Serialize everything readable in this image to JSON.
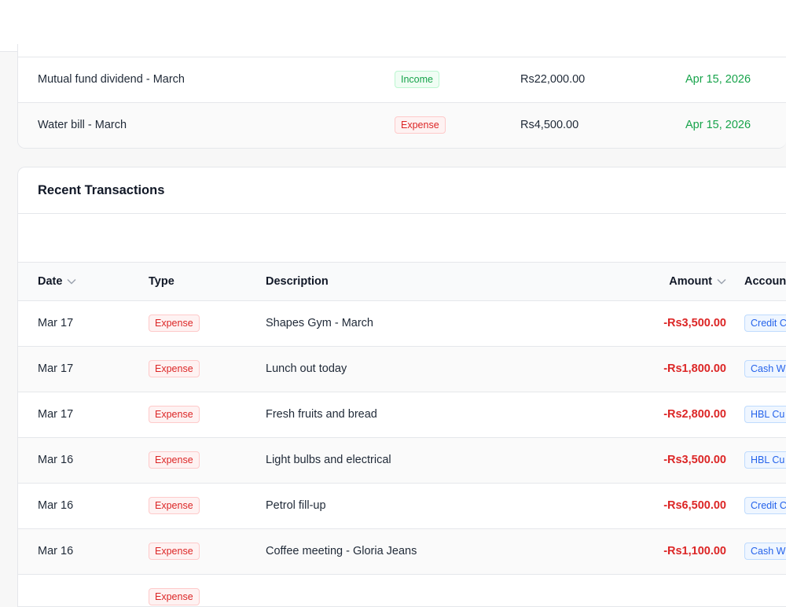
{
  "upcoming": {
    "rows": [
      {
        "description": "Mutual fund dividend - March",
        "type": "Income",
        "amount": "Rs22,000.00",
        "date": "Apr 15, 2026"
      },
      {
        "description": "Water bill - March",
        "type": "Expense",
        "amount": "Rs4,500.00",
        "date": "Apr 15, 2026"
      }
    ]
  },
  "recent": {
    "title": "Recent Transactions",
    "columns": {
      "date": "Date",
      "type": "Type",
      "description": "Description",
      "amount": "Amount",
      "account": "Accoun"
    },
    "rows": [
      {
        "date": "Mar 17",
        "type": "Expense",
        "description": "Shapes Gym - March",
        "amount": "-Rs3,500.00",
        "account": "Credit C"
      },
      {
        "date": "Mar 17",
        "type": "Expense",
        "description": "Lunch out today",
        "amount": "-Rs1,800.00",
        "account": "Cash W"
      },
      {
        "date": "Mar 17",
        "type": "Expense",
        "description": "Fresh fruits and bread",
        "amount": "-Rs2,800.00",
        "account": "HBL Cu"
      },
      {
        "date": "Mar 16",
        "type": "Expense",
        "description": "Light bulbs and electrical",
        "amount": "-Rs3,500.00",
        "account": "HBL Cu"
      },
      {
        "date": "Mar 16",
        "type": "Expense",
        "description": "Petrol fill-up",
        "amount": "-Rs6,500.00",
        "account": "Credit C"
      },
      {
        "date": "Mar 16",
        "type": "Expense",
        "description": "Coffee meeting - Gloria Jeans",
        "amount": "-Rs1,100.00",
        "account": "Cash W"
      },
      {
        "date": "",
        "type": "Expense",
        "description": "",
        "amount": "",
        "account": ""
      }
    ]
  },
  "icons": {
    "sort": "chevron-down-icon"
  },
  "colors": {
    "income": "#16a34a",
    "expense": "#dc2626",
    "account": "#2563eb"
  }
}
